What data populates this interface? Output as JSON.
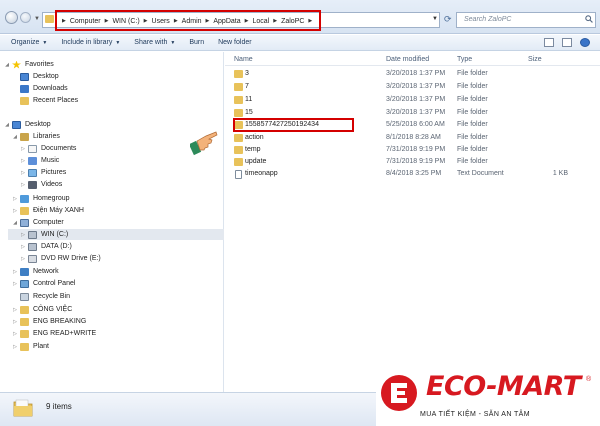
{
  "address": {
    "crumbs": [
      "Computer",
      "WIN (C:)",
      "Users",
      "Admin",
      "AppData",
      "Local",
      "ZaloPC"
    ],
    "search_placeholder": "Search ZaloPC"
  },
  "toolbar": {
    "organize": "Organize",
    "include": "Include in library",
    "share": "Share with",
    "burn": "Burn",
    "newfolder": "New folder"
  },
  "nav": {
    "favorites": "Favorites",
    "desktop_fav": "Desktop",
    "downloads": "Downloads",
    "recent": "Recent Places",
    "desktop": "Desktop",
    "libraries": "Libraries",
    "documents": "Documents",
    "music": "Music",
    "pictures": "Pictures",
    "videos": "Videos",
    "homegroup": "Homegroup",
    "dienmay": "Điện Máy XANH",
    "computer": "Computer",
    "winc": "WIN (C:)",
    "datad": "DATA (D:)",
    "dvd": "DVD RW Drive (E:)",
    "network": "Network",
    "controlpanel": "Control Panel",
    "recycle": "Recycle Bin",
    "congviec": "CÔNG VIỆC",
    "engbreaking": "ENG BREAKING",
    "engreadwrite": "ENG READ+WRITE",
    "plant": "Plant"
  },
  "columns": {
    "name": "Name",
    "date": "Date modified",
    "type": "Type",
    "size": "Size"
  },
  "files": [
    {
      "name": "3",
      "date": "3/20/2018 1:37 PM",
      "type": "File folder",
      "size": ""
    },
    {
      "name": "7",
      "date": "3/20/2018 1:37 PM",
      "type": "File folder",
      "size": ""
    },
    {
      "name": "11",
      "date": "3/20/2018 1:37 PM",
      "type": "File folder",
      "size": ""
    },
    {
      "name": "15",
      "date": "3/20/2018 1:37 PM",
      "type": "File folder",
      "size": ""
    },
    {
      "name": "1558577427250192434",
      "date": "5/25/2018 6:00 AM",
      "type": "File folder",
      "size": ""
    },
    {
      "name": "action",
      "date": "8/1/2018 8:28 AM",
      "type": "File folder",
      "size": ""
    },
    {
      "name": "temp",
      "date": "7/31/2018 9:19 PM",
      "type": "File folder",
      "size": ""
    },
    {
      "name": "update",
      "date": "7/31/2018 9:19 PM",
      "type": "File folder",
      "size": ""
    },
    {
      "name": "timeonapp",
      "date": "8/4/2018 3:25 PM",
      "type": "Text Document",
      "size": "1 KB"
    }
  ],
  "details": {
    "count": "9 items"
  },
  "brand": {
    "name": "ECO-MART",
    "reg": "®",
    "tagline": "MUA TIẾT KIỆM - SĂN AN TÂM"
  },
  "colors": {
    "highlight": "#d40000",
    "brand_red": "#d71920",
    "folder": "#e8c25a"
  }
}
